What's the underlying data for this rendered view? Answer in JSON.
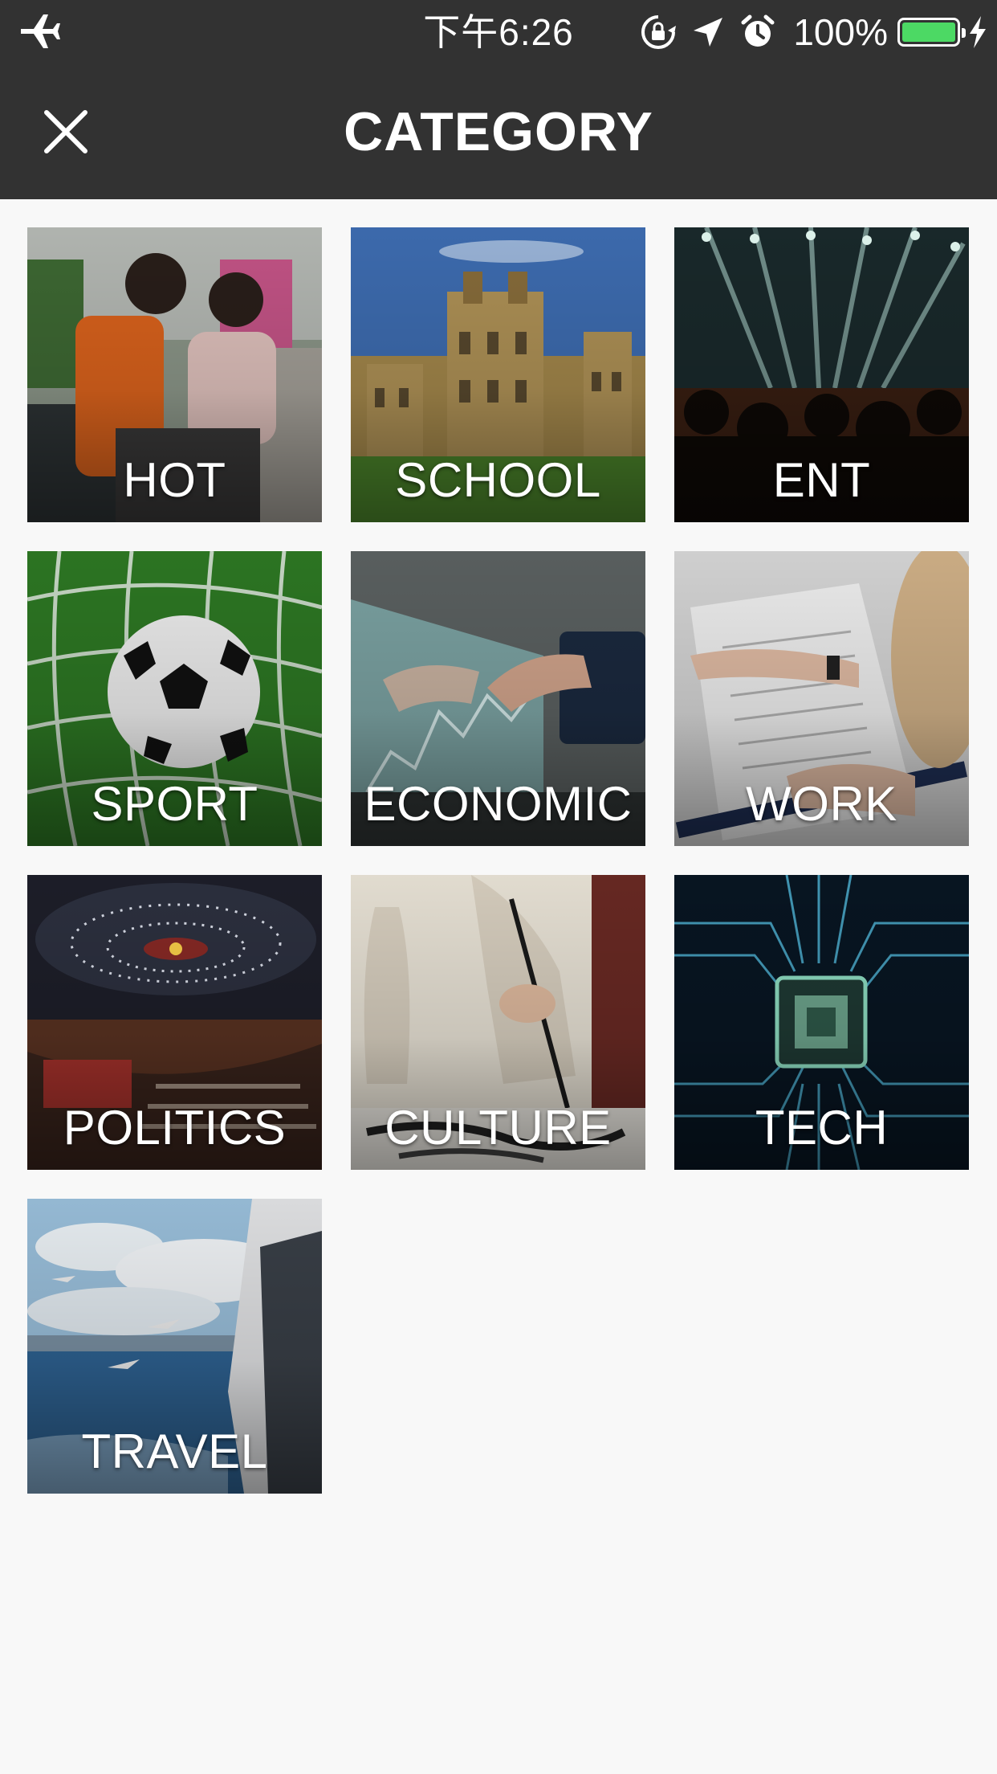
{
  "status_bar": {
    "time": "下午6:26",
    "battery_percent": "100%",
    "battery_level": 1.0,
    "icons": [
      "airplane-icon",
      "rotation-lock-icon",
      "location-arrow-icon",
      "alarm-icon",
      "battery-icon",
      "charging-bolt-icon"
    ]
  },
  "header": {
    "title": "CATEGORY",
    "close_icon": "close-icon"
  },
  "categories": [
    {
      "label": "HOT"
    },
    {
      "label": "SCHOOL"
    },
    {
      "label": "ENT"
    },
    {
      "label": "SPORT"
    },
    {
      "label": "ECONOMIC"
    },
    {
      "label": "WORK"
    },
    {
      "label": "POLITICS"
    },
    {
      "label": "CULTURE"
    },
    {
      "label": "TECH"
    },
    {
      "label": "TRAVEL"
    }
  ],
  "colors": {
    "bar_background": "#323232",
    "page_background": "#f8f8f8",
    "battery_fill": "#4cd964",
    "label_text": "#ffffff"
  }
}
